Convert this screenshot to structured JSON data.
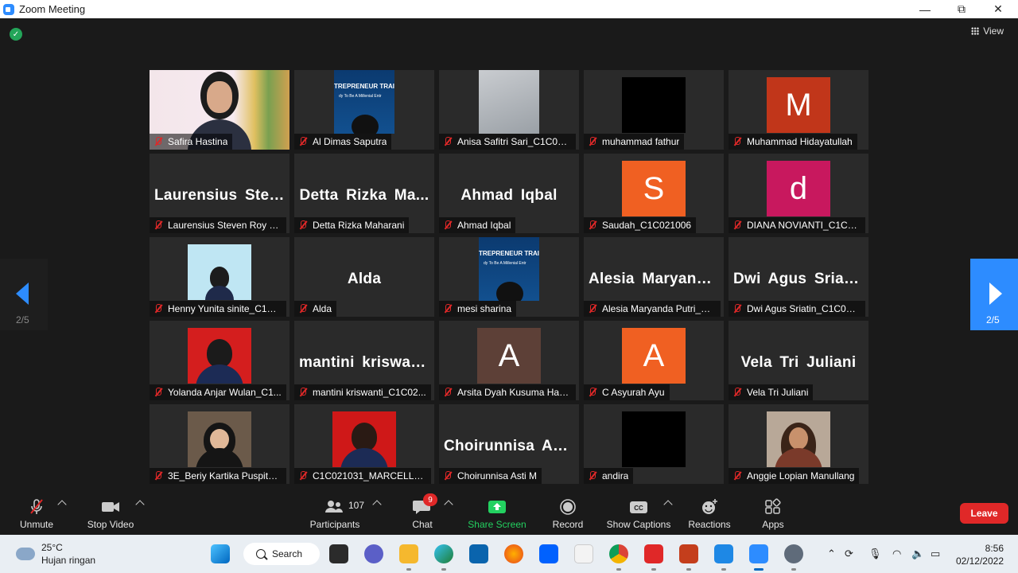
{
  "window": {
    "title": "Zoom Meeting",
    "minimize": "—",
    "maximize": "⧉",
    "close": "✕"
  },
  "top": {
    "view_label": "View"
  },
  "pager": {
    "left_page": "2/5",
    "right_page": "2/5"
  },
  "tiles": [
    {
      "label": "Safira Hastina",
      "type": "camera"
    },
    {
      "label": "Al Dimas Saputra",
      "type": "banner"
    },
    {
      "label": "Anisa Safitri Sari_C1C022...",
      "type": "photo"
    },
    {
      "label": "muhammad fathur",
      "type": "black"
    },
    {
      "label": "Muhammad Hidayatullah",
      "type": "avatar",
      "letter": "M",
      "color": "#c1361a"
    },
    {
      "label": "Laurensius Steven Roy M...",
      "type": "name",
      "big": "Laurensius  Stev..."
    },
    {
      "label": "Detta Rizka Maharani",
      "type": "name",
      "big": "Detta  Rizka  Ma..."
    },
    {
      "label": "Ahmad Iqbal",
      "type": "name",
      "big": "Ahmad  Iqbal"
    },
    {
      "label": "Saudah_C1C021006",
      "type": "avatar",
      "letter": "S",
      "color": "#f06022"
    },
    {
      "label": "DIANA NOVIANTI_C1C02...",
      "type": "avatar",
      "letter": "d",
      "color": "#c8185e"
    },
    {
      "label": "Henny Yunita sinite_C1C0...",
      "type": "photo-blue"
    },
    {
      "label": "Alda",
      "type": "name",
      "big": "Alda"
    },
    {
      "label": "mesi sharina",
      "type": "banner"
    },
    {
      "label": "Alesia Maryanda Putri_C1...",
      "type": "name",
      "big": "Alesia  Maryand..."
    },
    {
      "label": "Dwi Agus Sriatin_C1C022...",
      "type": "name",
      "big": "Dwi  Agus  Sriati..."
    },
    {
      "label": "Yolanda Anjar Wulan_C1...",
      "type": "photo-red"
    },
    {
      "label": "mantini kriswanti_C1C02...",
      "type": "name",
      "big": "mantini  kriswan..."
    },
    {
      "label": "Arsita Dyah Kusuma Had...",
      "type": "avatar",
      "letter": "A",
      "color": "#5d4037"
    },
    {
      "label": "C Asyurah Ayu",
      "type": "avatar",
      "letter": "A",
      "color": "#f06022"
    },
    {
      "label": "Vela Tri Juliani",
      "type": "name",
      "big": "Vela Tri Juliani"
    },
    {
      "label": "3E_Beriy Kartika Puspita S...",
      "type": "photo-hijab"
    },
    {
      "label": "C1C021031_MARCELLA P...",
      "type": "photo-red2"
    },
    {
      "label": "Choirunnisa Asti M",
      "type": "name",
      "big": "Choirunnisa  Ast..."
    },
    {
      "label": "andira",
      "type": "black"
    },
    {
      "label": "Anggie Lopian Manullang",
      "type": "photo-hair"
    }
  ],
  "banner": {
    "title": "TREPRENEUR TRAI",
    "subtitle": "dy To Be A Millenial Entr"
  },
  "toolbar": {
    "unmute": "Unmute",
    "stop_video": "Stop Video",
    "participants": "Participants",
    "participant_count": "107",
    "chat": "Chat",
    "chat_badge": "9",
    "share_screen": "Share Screen",
    "record": "Record",
    "captions": "Show Captions",
    "reactions": "Reactions",
    "apps": "Apps",
    "leave": "Leave"
  },
  "taskbar": {
    "temp": "25°C",
    "weather": "Hujan ringan",
    "search": "Search",
    "time": "8:56",
    "date": "02/12/2022"
  },
  "colors": {
    "accent": "#2d8cff",
    "leave": "#e02828",
    "share": "#23d160"
  }
}
